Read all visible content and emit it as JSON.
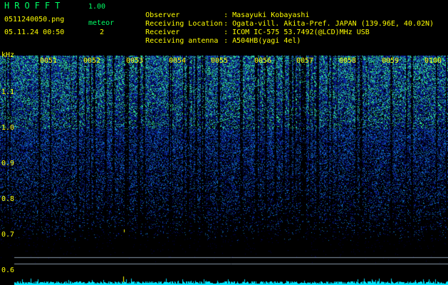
{
  "header": {
    "brand": "HROFFT",
    "version": "1.00",
    "filename": "0511240050.png",
    "datetime": "05.11.24 00:50",
    "meteor_label": "meteor",
    "meteor_count": "2",
    "info": [
      {
        "key": "Observer",
        "value": "Masayuki Kobayashi"
      },
      {
        "key": "Receiving Location",
        "value": "Ogata-vill. Akita-Pref. JAPAN (139.96E, 40.02N)"
      },
      {
        "key": "Receiver",
        "value": "ICOM IC-575 53.7492(@LCD)MHz USB"
      },
      {
        "key": "Receiving antenna",
        "value": "A504HB(yagi 4el)"
      }
    ]
  },
  "axis": {
    "unit": "kHz",
    "y_ticks": [
      "1.1",
      "1.0",
      "0.9",
      "0.8",
      "0.7",
      "0.6"
    ],
    "time_ticks": [
      "0051",
      "0052",
      "0053",
      "0054",
      "0055",
      "0056",
      "0057",
      "0058",
      "0059",
      "0100"
    ]
  },
  "colors": {
    "background": "#000000",
    "label_yellow": "#ffff00",
    "label_green": "#00ff66",
    "signal_low": "#0a1a8a",
    "signal_high": "#33ff99",
    "trace_cyan": "#00e5ff"
  }
}
